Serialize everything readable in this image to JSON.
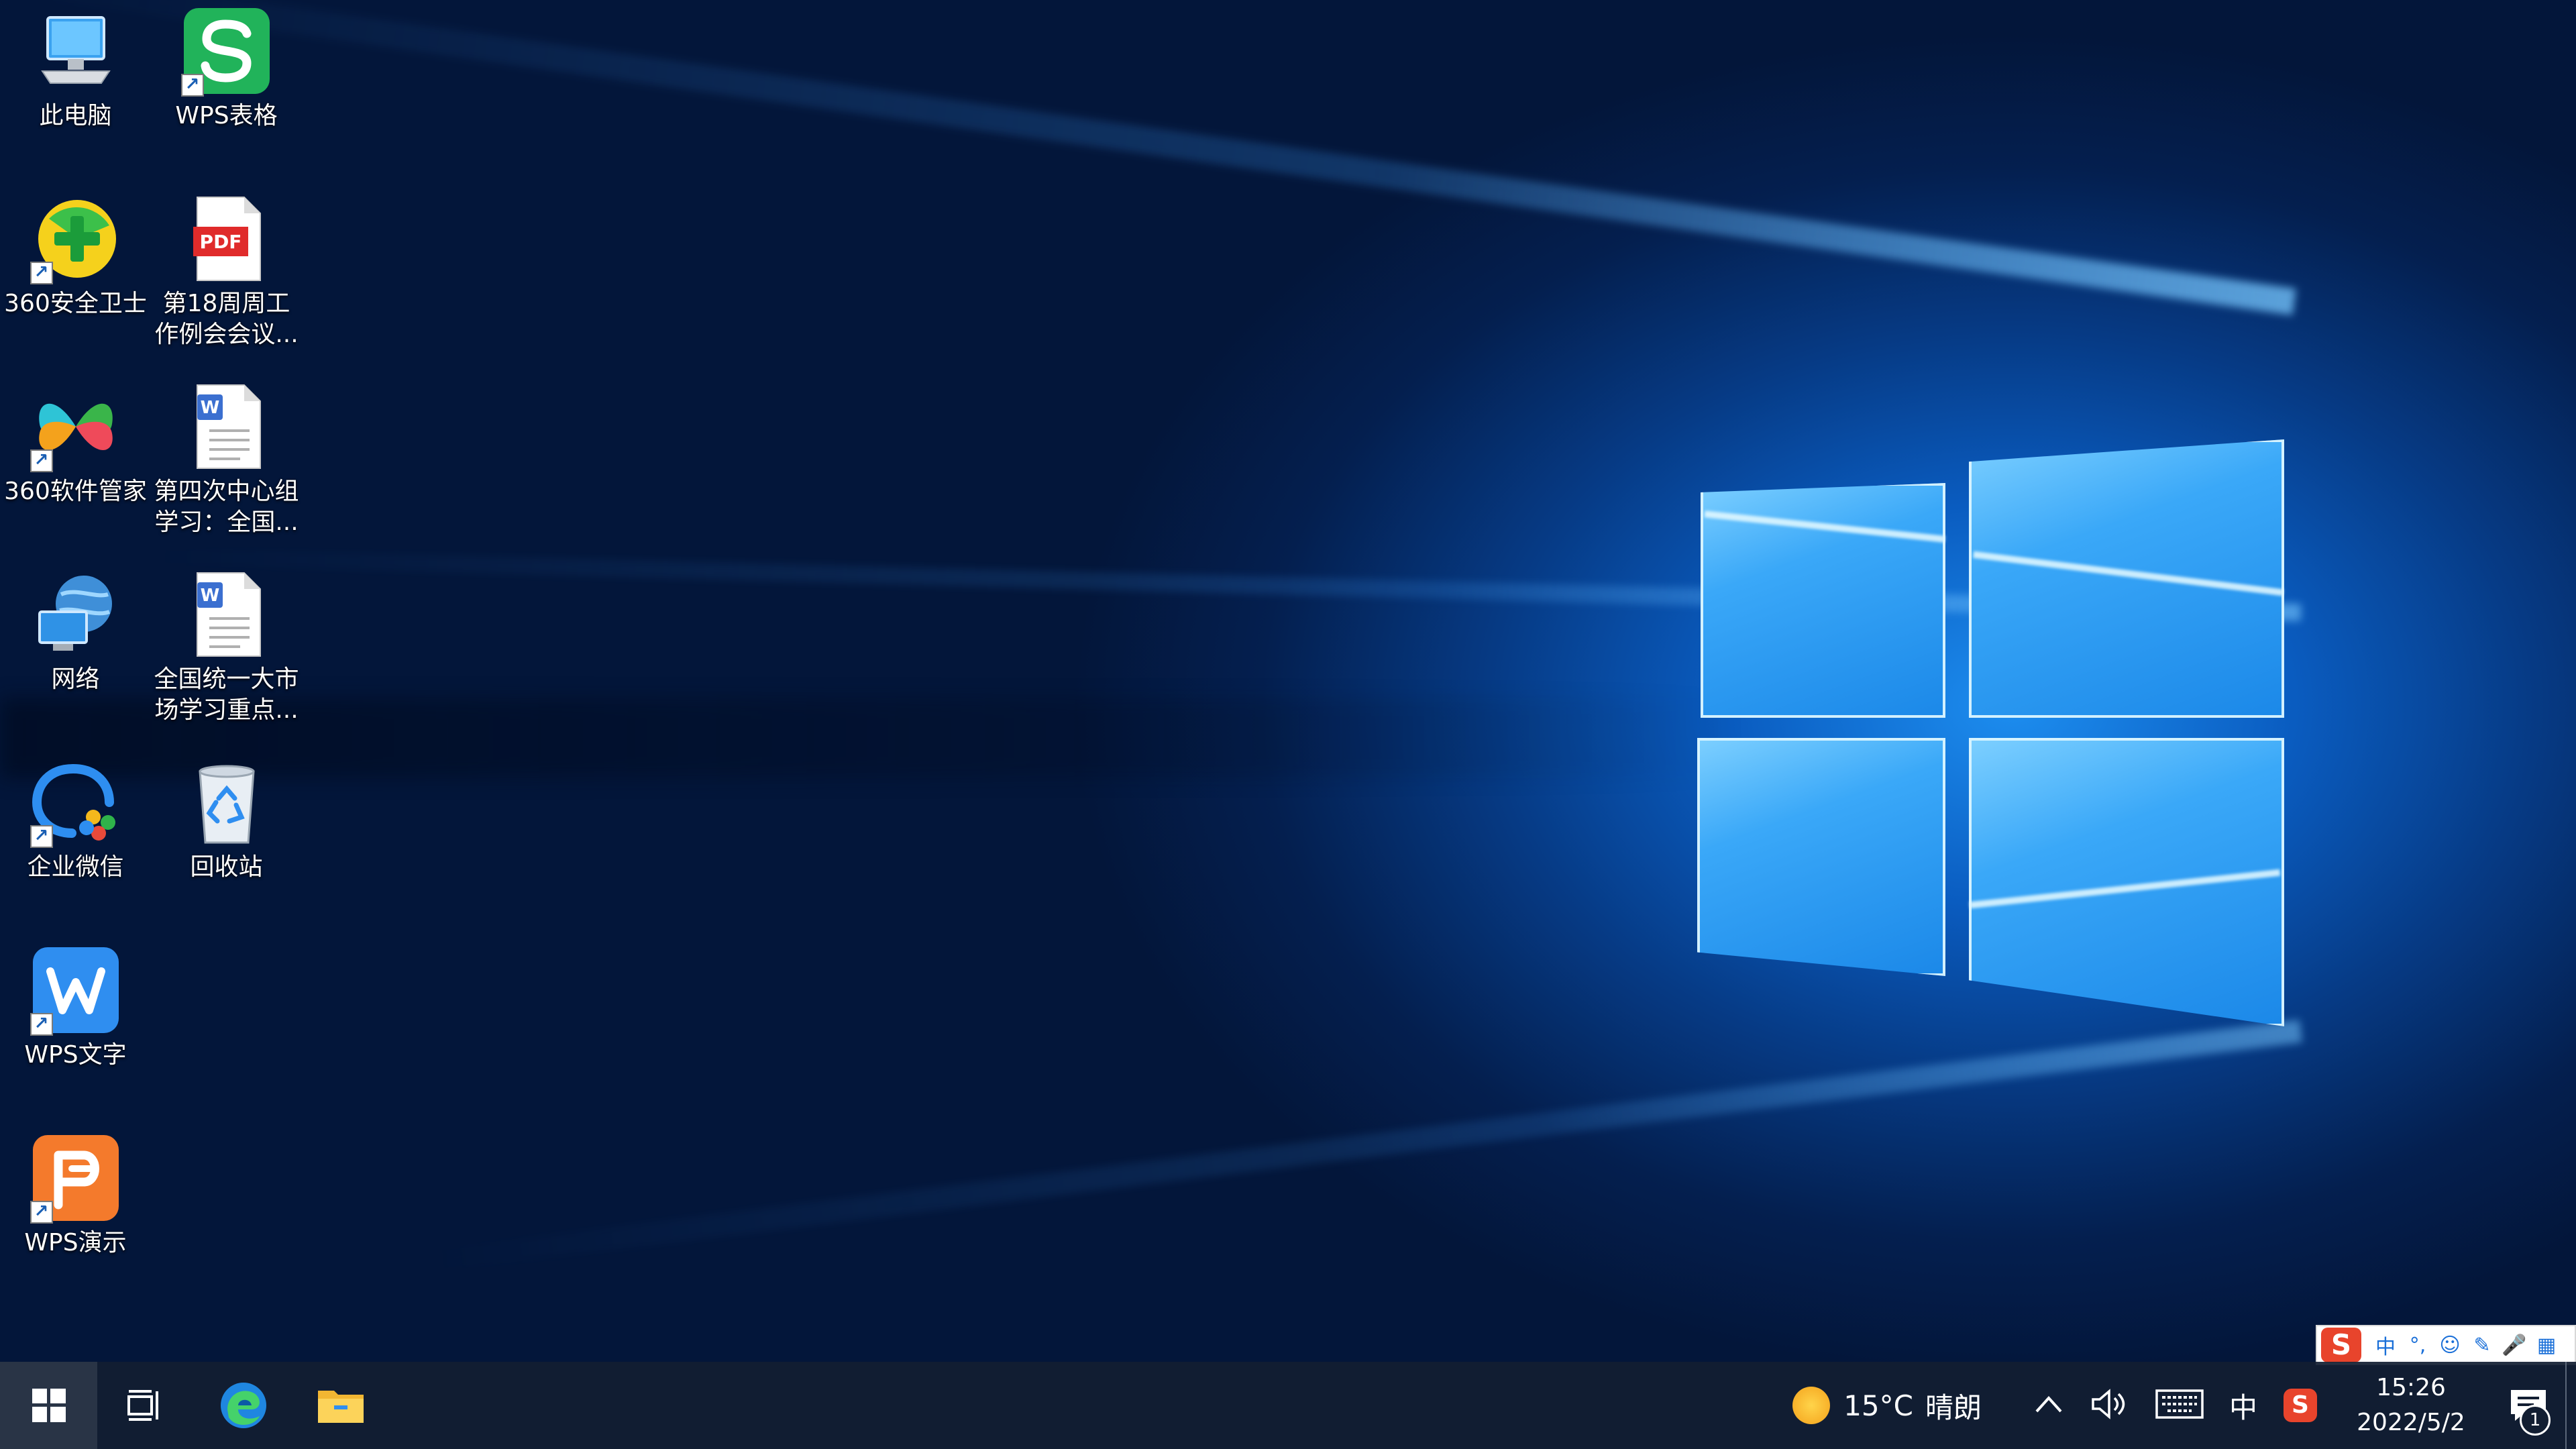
{
  "desktop": {
    "icons": [
      {
        "id": "this-pc",
        "label": "此电脑"
      },
      {
        "id": "wps-spreadsheet",
        "label": "WPS表格"
      },
      {
        "id": "360-safe",
        "label": "360安全卫士"
      },
      {
        "id": "pdf-meeting",
        "label": "第18周周工\n作例会会议...",
        "badge": "PDF"
      },
      {
        "id": "360-soft",
        "label": "360软件管家"
      },
      {
        "id": "doc-study1",
        "label": "第四次中心组\n学习：全国...",
        "badge": "W"
      },
      {
        "id": "network",
        "label": "网络"
      },
      {
        "id": "doc-study2",
        "label": "全国统一大市\n场学习重点...",
        "badge": "W"
      },
      {
        "id": "wecom",
        "label": "企业微信"
      },
      {
        "id": "recycle-bin",
        "label": "回收站"
      },
      {
        "id": "wps-writer",
        "label": "WPS文字"
      },
      {
        "id": "wps-presentation",
        "label": "WPS演示"
      }
    ]
  },
  "taskbar": {
    "weather": {
      "temp": "15°C",
      "desc": "晴朗"
    },
    "ime_indicator": "中",
    "clock": {
      "time": "15:26",
      "date": "2022/5/2"
    },
    "notification_count": "1"
  },
  "ime_toolbar": {
    "logo": "S",
    "items": [
      "中",
      "°,",
      "☺",
      "✎",
      "🎤",
      "▦"
    ]
  },
  "colors": {
    "taskbar_bg": "#121e32",
    "wps_green": "#21b35a",
    "wps_blue": "#2f8ef0",
    "wps_orange": "#f47a2c",
    "sogou_red": "#e8442c"
  }
}
